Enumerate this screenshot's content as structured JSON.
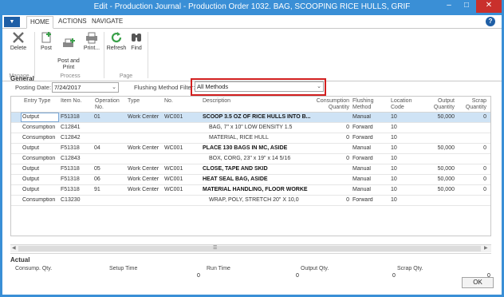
{
  "window": {
    "title": "Edit - Production Journal - Production Order 1032. BAG, SCOOPING RICE HULLS, GRIF"
  },
  "tabs": [
    "HOME",
    "ACTIONS",
    "NAVIGATE"
  ],
  "help_icon": "?",
  "ribbon": {
    "manage": {
      "label": "Manage",
      "buttons": {
        "delete": "Delete"
      }
    },
    "process": {
      "label": "Process",
      "buttons": {
        "post": "Post",
        "post_and_print": "Post and\nPrint",
        "print": "Print..."
      }
    },
    "page": {
      "label": "Page",
      "buttons": {
        "refresh": "Refresh",
        "find": "Find"
      }
    }
  },
  "general": {
    "title": "General",
    "posting_date_label": "Posting Date:",
    "posting_date": "7/24/2017",
    "flushing_label": "Flushing Method Filter:",
    "flushing_value": "All Methods"
  },
  "grid": {
    "headers": [
      "Entry Type",
      "Item No.",
      "Operation No.",
      "Type",
      "No.",
      "Description",
      "Consumption Quantity",
      "Flushing Method",
      "Location Code",
      "Output Quantity",
      "Scrap Quantity"
    ],
    "rows": [
      {
        "entry": "Output",
        "item": "F51318",
        "op": "01",
        "type": "Work Center",
        "no": "WC001",
        "desc": "SCOOP 3.5 OZ OF RICE HULLS INTO B...",
        "cons": "",
        "flush": "Manual",
        "loc": "10",
        "out": "50,000",
        "scrap": "0"
      },
      {
        "entry": "Consumption",
        "item": "C12841",
        "op": "",
        "type": "",
        "no": "",
        "desc": "BAG, 7\" x 10\" LOW DENSITY 1.5",
        "cons": "0",
        "flush": "Forward",
        "loc": "10",
        "out": "",
        "scrap": ""
      },
      {
        "entry": "Consumption",
        "item": "C12842",
        "op": "",
        "type": "",
        "no": "",
        "desc": "MATERIAL, RICE HULL",
        "cons": "0",
        "flush": "Forward",
        "loc": "10",
        "out": "",
        "scrap": ""
      },
      {
        "entry": "Output",
        "item": "F51318",
        "op": "04",
        "type": "Work Center",
        "no": "WC001",
        "desc": "PLACE 130 BAGS IN MC, ASIDE",
        "cons": "",
        "flush": "Manual",
        "loc": "10",
        "out": "50,000",
        "scrap": "0"
      },
      {
        "entry": "Consumption",
        "item": "C12843",
        "op": "",
        "type": "",
        "no": "",
        "desc": "BOX, CORG, 23\" x 19\" x 14 5/16",
        "cons": "0",
        "flush": "Forward",
        "loc": "10",
        "out": "",
        "scrap": ""
      },
      {
        "entry": "Output",
        "item": "F51318",
        "op": "05",
        "type": "Work Center",
        "no": "WC001",
        "desc": "CLOSE, TAPE AND SKID",
        "cons": "",
        "flush": "Manual",
        "loc": "10",
        "out": "50,000",
        "scrap": "0"
      },
      {
        "entry": "Output",
        "item": "F51318",
        "op": "06",
        "type": "Work Center",
        "no": "WC001",
        "desc": "HEAT SEAL BAG, ASIDE",
        "cons": "",
        "flush": "Manual",
        "loc": "10",
        "out": "50,000",
        "scrap": "0"
      },
      {
        "entry": "Output",
        "item": "F51318",
        "op": "91",
        "type": "Work Center",
        "no": "WC001",
        "desc": "MATERIAL HANDLING, FLOOR WORKE",
        "cons": "",
        "flush": "Manual",
        "loc": "10",
        "out": "50,000",
        "scrap": "0"
      },
      {
        "entry": "Consumption",
        "item": "C13230",
        "op": "",
        "type": "",
        "no": "",
        "desc": "WRAP, POLY, STRETCH 20\" X 10,0",
        "cons": "0",
        "flush": "Forward",
        "loc": "10",
        "out": "",
        "scrap": ""
      }
    ]
  },
  "actual": {
    "title": "Actual",
    "labels": [
      "Consump. Qty.",
      "Setup Time",
      "Run Time",
      "Output Qty.",
      "Scrap Qty."
    ],
    "values": [
      "",
      "0",
      "0",
      "0",
      "0"
    ]
  },
  "ok_label": "OK"
}
